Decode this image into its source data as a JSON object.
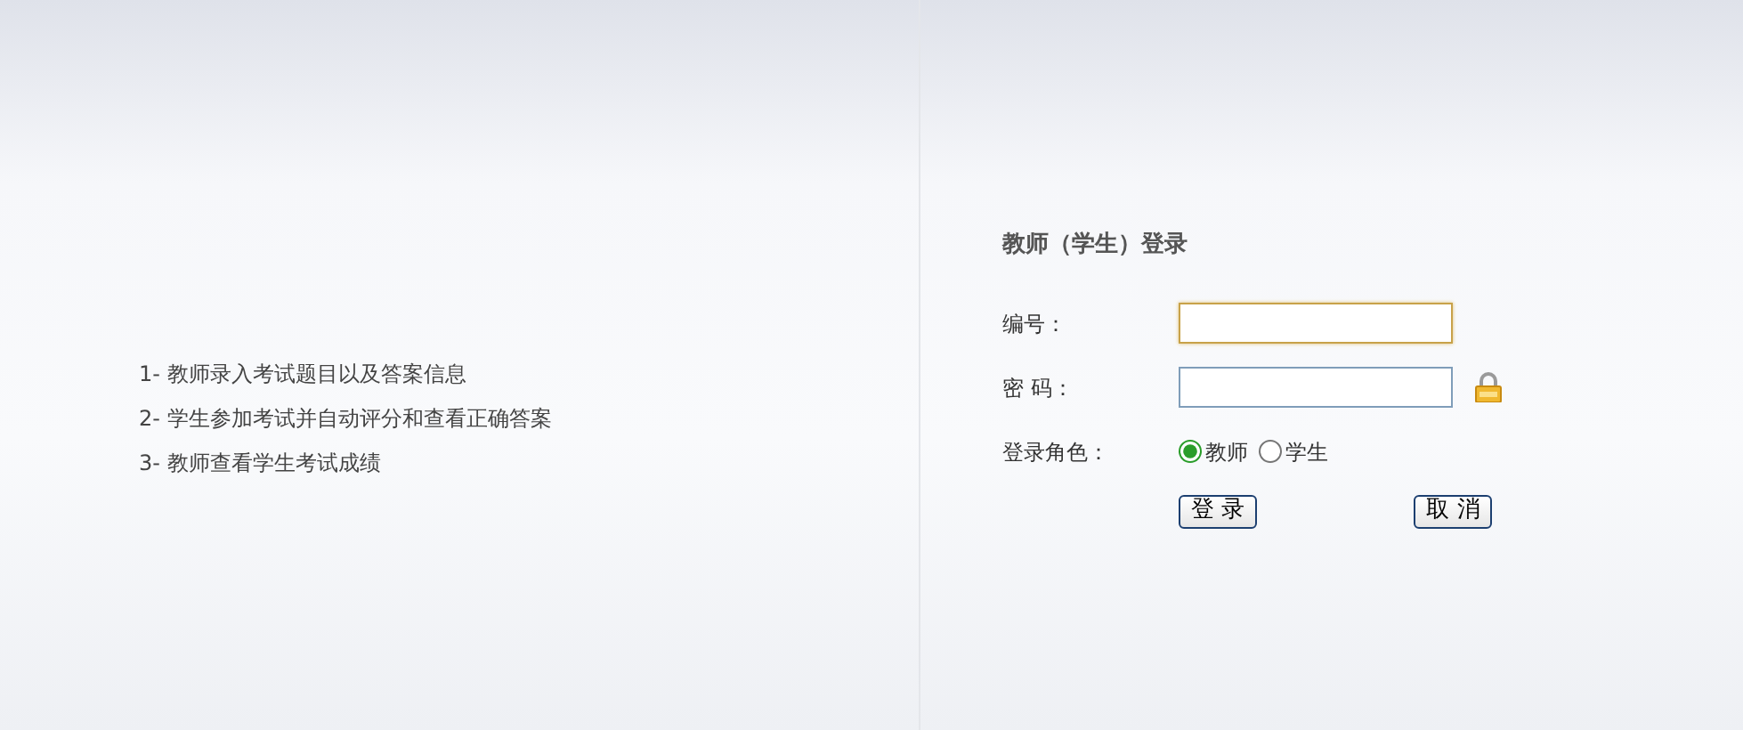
{
  "features": [
    "1- 教师录入考试题目以及答案信息",
    "2- 学生参加考试并自动评分和查看正确答案",
    "3- 教师查看学生考试成绩"
  ],
  "login": {
    "title": "教师（学生）登录",
    "fields": [
      {
        "label": "编号：",
        "kind": "text",
        "focused": true
      },
      {
        "label": "密 码：",
        "kind": "password",
        "focused": false
      }
    ],
    "role": {
      "label": "登录角色：",
      "options": [
        {
          "label": "教师",
          "selected": true
        },
        {
          "label": "学生",
          "selected": false
        }
      ]
    },
    "buttons": [
      "登 录",
      "取 消"
    ]
  }
}
